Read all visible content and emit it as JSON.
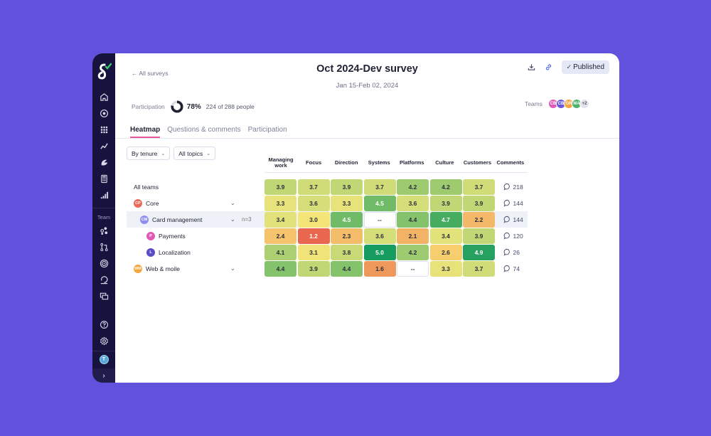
{
  "sidebar": {
    "team_label": "Team",
    "avatar_initials": "T"
  },
  "header": {
    "back_label": "← All surveys",
    "title": "Oct 2024-Dev survey",
    "dates": "Jan 15-Feb 02, 2024",
    "published_label": "Published"
  },
  "participation": {
    "label": "Participation",
    "percent": 78,
    "percent_label": "78%",
    "count_label": "224 of 288 people"
  },
  "teams": {
    "label": "Teams",
    "chips": [
      {
        "initials": "CB",
        "color": "#e05ab8"
      },
      {
        "initials": "CB",
        "color": "#6a5ad8"
      },
      {
        "initials": "GR",
        "color": "#f5a53e"
      },
      {
        "initials": "MA",
        "color": "#4db36b"
      }
    ],
    "more_label": "+2"
  },
  "tabs": [
    {
      "label": "Heatmap",
      "active": true
    },
    {
      "label": "Questions & comments",
      "active": false
    },
    {
      "label": "Participation",
      "active": false
    }
  ],
  "filters": {
    "group_by": "By tenure",
    "topics": "All topics"
  },
  "heatmap": {
    "columns": [
      "Managing work",
      "Focus",
      "Direction",
      "Systems",
      "Platforms",
      "Culture",
      "Customers"
    ],
    "comments_header": "Comments",
    "rows": [
      {
        "label": "All teams",
        "avatar": "",
        "avatar_color": "",
        "indent": 0,
        "expandable": false,
        "values": [
          "3.9",
          "3.7",
          "3.9",
          "3.7",
          "4.2",
          "4.2",
          "3.7"
        ],
        "comments": "218"
      },
      {
        "label": "Core",
        "avatar": "CP",
        "avatar_color": "#ea6a5a",
        "indent": 0,
        "expandable": true,
        "values": [
          "3.3",
          "3.6",
          "3.3",
          "4.5",
          "3.6",
          "3.9",
          "3.9"
        ],
        "comments": "144"
      },
      {
        "label": "Card management",
        "avatar": "CM",
        "avatar_color": "#8f8ef0",
        "indent": 1,
        "expandable": true,
        "n_label": "n=3",
        "highlight": true,
        "values": [
          "3.4",
          "3.0",
          "4.5",
          "--",
          "4.4",
          "4.7",
          "2.2"
        ],
        "comments": "144"
      },
      {
        "label": "Payments",
        "avatar": "P",
        "avatar_color": "#e05ab8",
        "indent": 2,
        "expandable": false,
        "values": [
          "2.4",
          "1.2",
          "2.3",
          "3.6",
          "2.1",
          "3.4",
          "3.9"
        ],
        "comments": "120"
      },
      {
        "label": "Localization",
        "avatar": "L",
        "avatar_color": "#5a4cc8",
        "indent": 2,
        "expandable": false,
        "values": [
          "4.1",
          "3.1",
          "3.8",
          "5.0",
          "4.2",
          "2.6",
          "4.9"
        ],
        "comments": "26"
      },
      {
        "label": "Web & moile",
        "avatar": "WM",
        "avatar_color": "#f5a53e",
        "indent": 0,
        "expandable": true,
        "values": [
          "4.4",
          "3.9",
          "4.4",
          "1.6",
          "--",
          "3.3",
          "3.7"
        ],
        "comments": "74"
      }
    ]
  }
}
